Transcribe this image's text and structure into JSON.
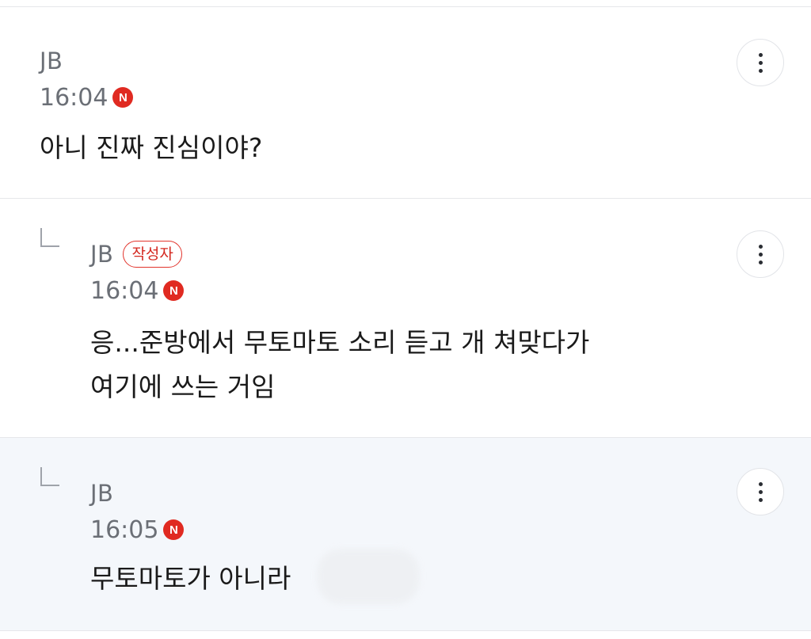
{
  "comments": [
    {
      "author": "JB",
      "time": "16:04",
      "n_badge": "N",
      "text": "아니 진짜 진심이야?",
      "is_reply": false
    },
    {
      "author": "JB",
      "author_badge": "작성자",
      "time": "16:04",
      "n_badge": "N",
      "text_line1": "응...준방에서 무토마토 소리 듣고 개 쳐맞다가",
      "text_line2": "여기에 쓰는 거임",
      "is_reply": true
    },
    {
      "author": "JB",
      "time": "16:05",
      "n_badge": "N",
      "text": "무토마토가 아니라",
      "is_reply": true,
      "highlighted": true
    }
  ],
  "icons": {
    "more": "more-vertical-icon",
    "reply": "reply-arrow-icon",
    "new": "new-n-icon"
  },
  "colors": {
    "accent_red": "#e02a21",
    "highlight_bg": "#f4f7fb"
  }
}
